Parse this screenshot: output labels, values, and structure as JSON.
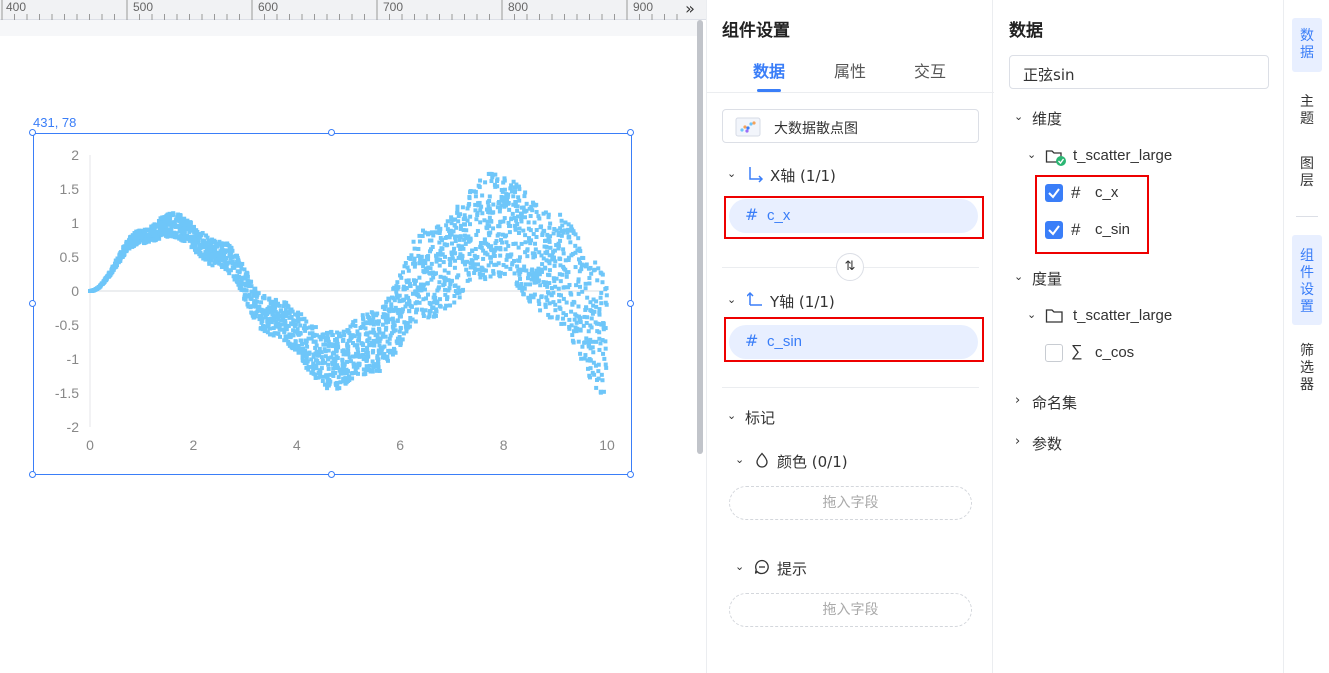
{
  "canvas": {
    "ruler_labels": [
      "400",
      "500",
      "600",
      "700",
      "800",
      "900"
    ],
    "expand_icon": "double-chevron-right-icon",
    "selection_coord": "431, 78"
  },
  "chart_data": {
    "type": "scatter",
    "title": "",
    "xlabel": "",
    "ylabel": "",
    "xlim": [
      0,
      10
    ],
    "ylim": [
      -2,
      2
    ],
    "x_ticks": [
      "0",
      "2",
      "4",
      "6",
      "8",
      "10"
    ],
    "y_ticks": [
      "2",
      "1.5",
      "1",
      "0.5",
      "0",
      "-0.5",
      "-1",
      "-1.5",
      "-2"
    ],
    "color": "#6ec6f9",
    "series": [
      {
        "band": [
          {
            "x": 0,
            "lower": 0,
            "upper": 0
          },
          {
            "x": 1,
            "lower": 0.7,
            "upper": 0.9
          },
          {
            "x": 1.57,
            "lower": 0.8,
            "upper": 1.15
          },
          {
            "x": 2.5,
            "lower": 0.35,
            "upper": 0.75
          },
          {
            "x": 3.5,
            "lower": -0.65,
            "upper": -0.1
          },
          {
            "x": 4.7,
            "lower": -1.45,
            "upper": -0.6
          },
          {
            "x": 5.5,
            "lower": -1.2,
            "upper": -0.3
          },
          {
            "x": 6.5,
            "lower": -0.4,
            "upper": 0.9
          },
          {
            "x": 7.85,
            "lower": 0.2,
            "upper": 1.75
          },
          {
            "x": 9,
            "lower": -0.45,
            "upper": 1.15
          },
          {
            "x": 10,
            "lower": -1.55,
            "upper": 0.35
          }
        ]
      }
    ]
  },
  "settings": {
    "title": "组件设置",
    "tabs": [
      "数据",
      "属性",
      "交互"
    ],
    "chart_type": "大数据散点图",
    "x_axis_label": "X轴 (1/1)",
    "x_field": "c_x",
    "y_axis_label": "Y轴 (1/1)",
    "y_field": "c_sin",
    "swap_icon": "swap-arrows-icon",
    "mark_label": "标记",
    "color_label": "颜色 (0/1)",
    "drop_placeholder": "拖入字段",
    "tooltip_label": "提示",
    "drop_placeholder_2": "拖入字段"
  },
  "data_panel": {
    "title": "数据",
    "dataset": "正弦sin",
    "dimensions_label": "维度",
    "dim_table": "t_scatter_large",
    "dim_fields": [
      "c_x",
      "c_sin"
    ],
    "measures_label": "度量",
    "measure_table": "t_scatter_large",
    "measure_fields": [
      "c_cos"
    ],
    "named_sets_label": "命名集",
    "params_label": "参数"
  },
  "rail": {
    "items": [
      "数据",
      "主题",
      "图层",
      "组件设置",
      "筛选器"
    ]
  },
  "colors": {
    "accent": "#3a7ef8",
    "highlight": "#e00000",
    "scatter": "#6ec6f9"
  }
}
